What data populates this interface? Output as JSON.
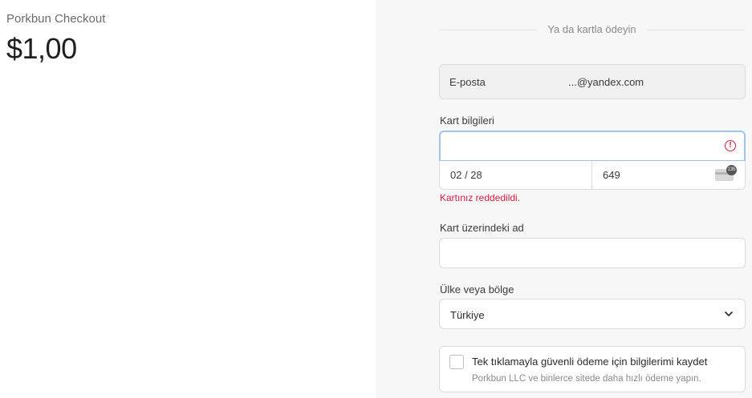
{
  "merchant": {
    "name": "Porkbun Checkout",
    "amount": "$1,00"
  },
  "divider": {
    "text": "Ya da kartla ödeyin"
  },
  "email": {
    "label": "E-posta",
    "value": "...@yandex.com"
  },
  "card": {
    "label": "Kart bilgileri",
    "number": "",
    "expiry": "02 / 28",
    "cvc": "649",
    "cvc_badge": "135",
    "error": "Kartınız reddedildi."
  },
  "name_on_card": {
    "label": "Kart üzerindeki ad",
    "value": ""
  },
  "country": {
    "label": "Ülke veya bölge",
    "selected": "Türkiye"
  },
  "save_info": {
    "title": "Tek tıklamayla güvenli ödeme için bilgilerimi kaydet",
    "subtitle": "Porkbun LLC ve binlerce sitede daha hızlı ödeme yapın."
  },
  "colors": {
    "error": "#df1b41",
    "focus": "#9ec5f0",
    "panel": "#f7f7f7"
  }
}
